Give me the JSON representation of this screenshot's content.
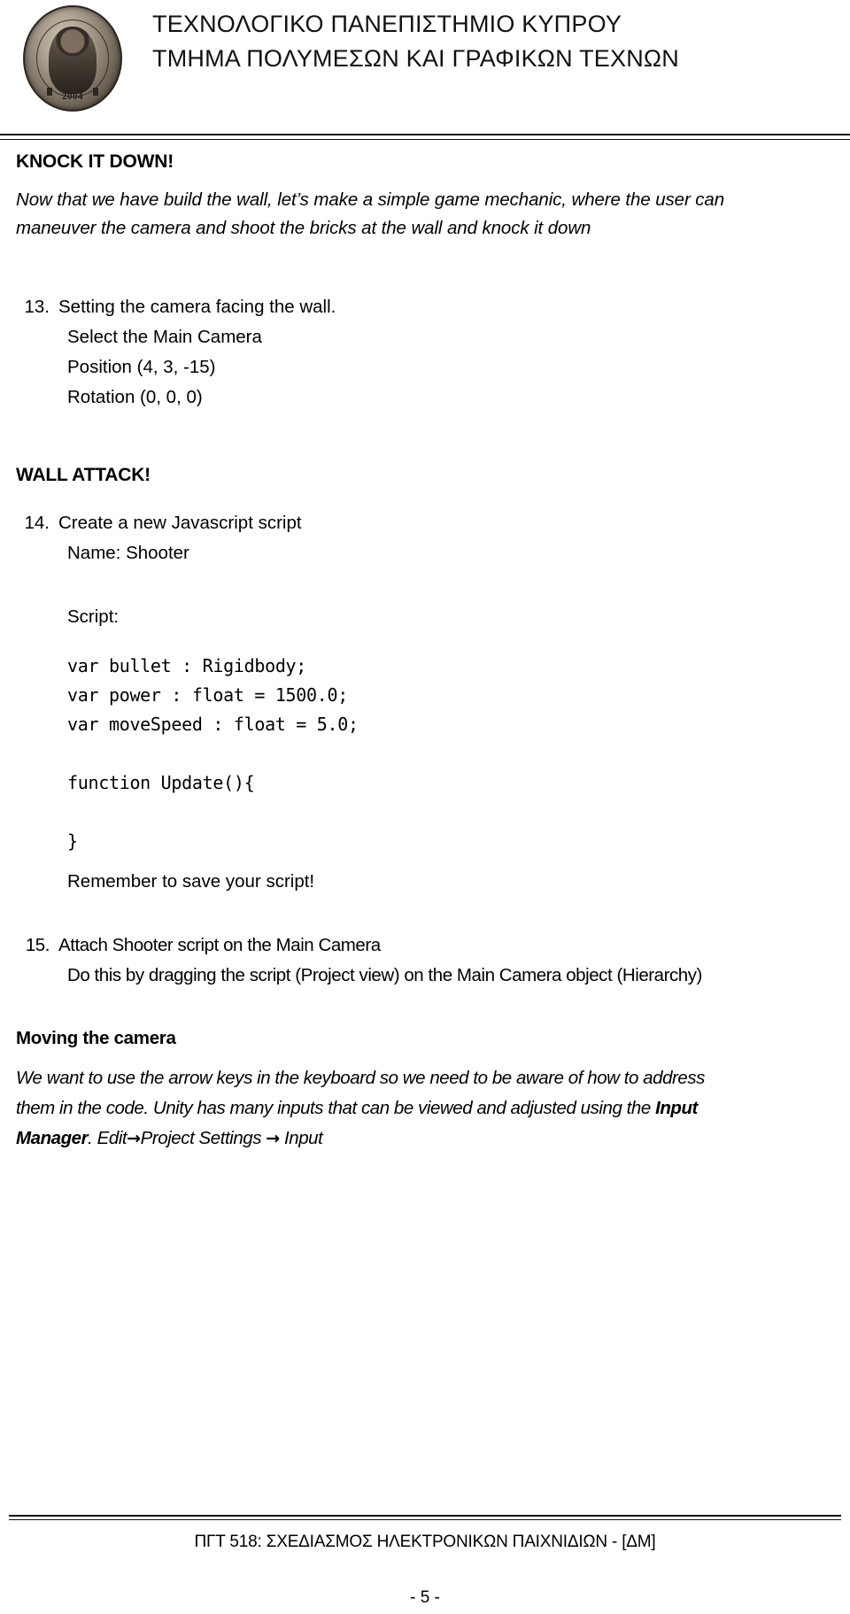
{
  "header": {
    "logo": {
      "icon": "university-seal-logo",
      "year": "2004",
      "ring_text": "ΤΕΧΝΟΛΟΓΙΚΟ ΠΑΝΕΠΙΣΤΗΜΙΟ ΚΥΠΡΟΥ"
    },
    "line1": "ΤΕΧΝΟΛΟΓΙΚΟ ΠΑΝΕΠΙΣΤΗΜΙΟ ΚΥΠΡΟΥ",
    "line2": "ΤΜΗΜΑ ΠΟΛΥΜΕΣΩΝ ΚΑΙ ΓΡΑΦΙΚΩΝ ΤΕΧΝΩΝ"
  },
  "body": {
    "section1_heading": "KNOCK IT DOWN!",
    "section1_para_line1": "Now that we have build the wall, let’s make a simple game mechanic, where the user can",
    "section1_para_line2": "maneuver the camera and shoot the bricks at the wall and knock it down",
    "item13": {
      "number": "13.",
      "text": "Setting the camera facing the wall.",
      "sub1": "Select the Main Camera",
      "sub2": "Position (4, 3, -15)",
      "sub3": "Rotation (0, 0, 0)"
    },
    "section2_heading": "WALL ATTACK!",
    "item14": {
      "number": "14.",
      "text": "Create a new Javascript script",
      "sub1": "Name: Shooter",
      "sub2": "Script:"
    },
    "code": {
      "line1": "var bullet : Rigidbody;",
      "line2": "var power : float = 1500.0;",
      "line3": "var moveSpeed : float = 5.0;",
      "line4": "function Update(){",
      "line5": "}"
    },
    "remember_note": "Remember to save your script!",
    "item15": {
      "number": "15.",
      "text": "Attach Shooter script on the Main Camera",
      "sub1": "Do this by dragging the script (Project view) on the Main Camera object (Hierarchy)"
    },
    "section3_heading": "Moving the camera",
    "section3_para_line1": "We want to use the arrow keys in the  keyboard so we need to be aware of how to address",
    "section3_para_line2_a": "them in the code. Unity has many inputs that can be viewed and adjusted using the ",
    "section3_para_line2_b": "Input",
    "section3_para_line3_a": "Manager",
    "section3_para_line3_b": ". Edit",
    "section3_arrow1": "→",
    "section3_para_line3_c": "Project Settings ",
    "section3_arrow2": "→",
    "section3_para_line3_d": " Input"
  },
  "footer": {
    "course": "ΠΓΤ 518: ΣΧΕΔΙΑΣΜΟΣ ΗΛΕΚΤΡΟΝΙΚΩΝ ΠΑΙΧΝΙΔΙΩΝ - [ΔΜ]",
    "page": "- 5 -"
  },
  "colors": {
    "text": "#000000",
    "rule": "#111111",
    "page_background": "#ffffff"
  }
}
